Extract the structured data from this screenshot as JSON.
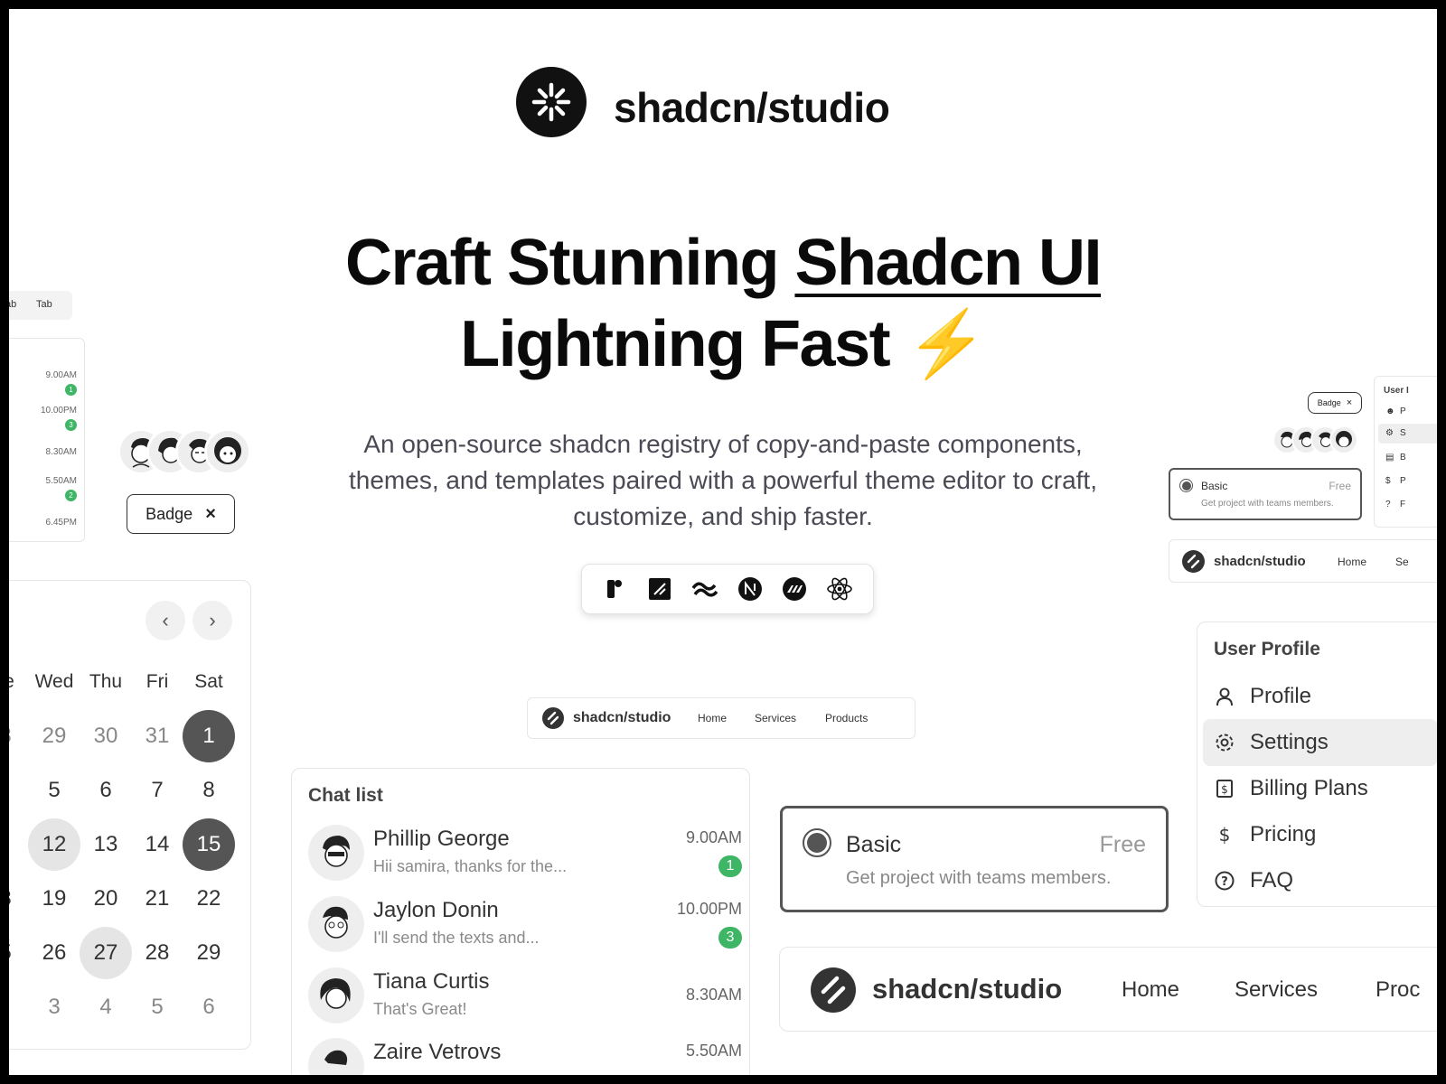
{
  "brand": {
    "name": "shadcn/studio"
  },
  "hero": {
    "headline_part1": "Craft Stunning",
    "headline_highlight": "Shadcn UI",
    "headline_line2": "Lightning Fast",
    "headline_emoji": "⚡",
    "subtitle": "An open-source shadcn registry of copy-and-paste components, themes, and templates paired with a powerful theme editor to craft, customize, and ship faster."
  },
  "tech_stack": [
    "figma-icon",
    "shadcn-icon",
    "tailwind-icon",
    "nextjs-icon",
    "motion-icon",
    "react-icon"
  ],
  "tabs_fragment": {
    "tab1": "ab",
    "tab2": "Tab"
  },
  "mini_chat_times": [
    {
      "time": "9.00AM",
      "count": "1"
    },
    {
      "time": "10.00PM",
      "count": "3"
    },
    {
      "time": "8.30AM",
      "count": ""
    },
    {
      "time": "5.50AM",
      "count": "2"
    },
    {
      "time": "6.45PM",
      "count": ""
    }
  ],
  "badge": {
    "label": "Badge",
    "close": "×"
  },
  "calendar": {
    "headers": [
      "e",
      "Wed",
      "Thu",
      "Fri",
      "Sat"
    ],
    "rows": [
      [
        "8",
        "29",
        "30",
        "31",
        "1"
      ],
      [
        "",
        "5",
        "6",
        "7",
        "8"
      ],
      [
        "",
        "12",
        "13",
        "14",
        "15"
      ],
      [
        "8",
        "19",
        "20",
        "21",
        "22"
      ],
      [
        "5",
        "26",
        "27",
        "28",
        "29"
      ],
      [
        "",
        "3",
        "4",
        "5",
        "6"
      ]
    ],
    "prev": "‹",
    "next": "›"
  },
  "navbar_small": {
    "brand": "shadcn/studio",
    "links": [
      "Home",
      "Services",
      "Products"
    ]
  },
  "chat_list": {
    "title": "Chat list",
    "items": [
      {
        "name": "Phillip George",
        "message": "Hii samira, thanks for the...",
        "time": "9.00AM",
        "count": "1"
      },
      {
        "name": "Jaylon Donin",
        "message": "I'll send the texts and...",
        "time": "10.00PM",
        "count": "3"
      },
      {
        "name": "Tiana Curtis",
        "message": "That's Great!",
        "time": "8.30AM",
        "count": ""
      },
      {
        "name": "Zaire Vetrovs",
        "message": "",
        "time": "5.50AM",
        "count": ""
      }
    ]
  },
  "plan_card": {
    "name": "Basic",
    "price": "Free",
    "description": "Get project with teams members."
  },
  "navbar_large": {
    "brand": "shadcn/studio",
    "links": [
      "Home",
      "Services",
      "Proc"
    ]
  },
  "user_profile_menu": {
    "title": "User Profile",
    "items": [
      {
        "label": "Profile",
        "icon": "user-icon"
      },
      {
        "label": "Settings",
        "icon": "gear-icon",
        "active": true
      },
      {
        "label": "Billing Plans",
        "icon": "billing-icon"
      },
      {
        "label": "Pricing",
        "icon": "dollar-icon"
      },
      {
        "label": "FAQ",
        "icon": "help-circle-icon"
      }
    ]
  },
  "right_small": {
    "badge": "Badge",
    "menu_title": "User I",
    "menu_letters": [
      "P",
      "S",
      "B",
      "P",
      "F"
    ],
    "plan_name": "Basic",
    "plan_price": "Free",
    "plan_desc": "Get project with teams members.",
    "nav_brand": "shadcn/studio",
    "nav_links": [
      "Home",
      "Se"
    ]
  }
}
